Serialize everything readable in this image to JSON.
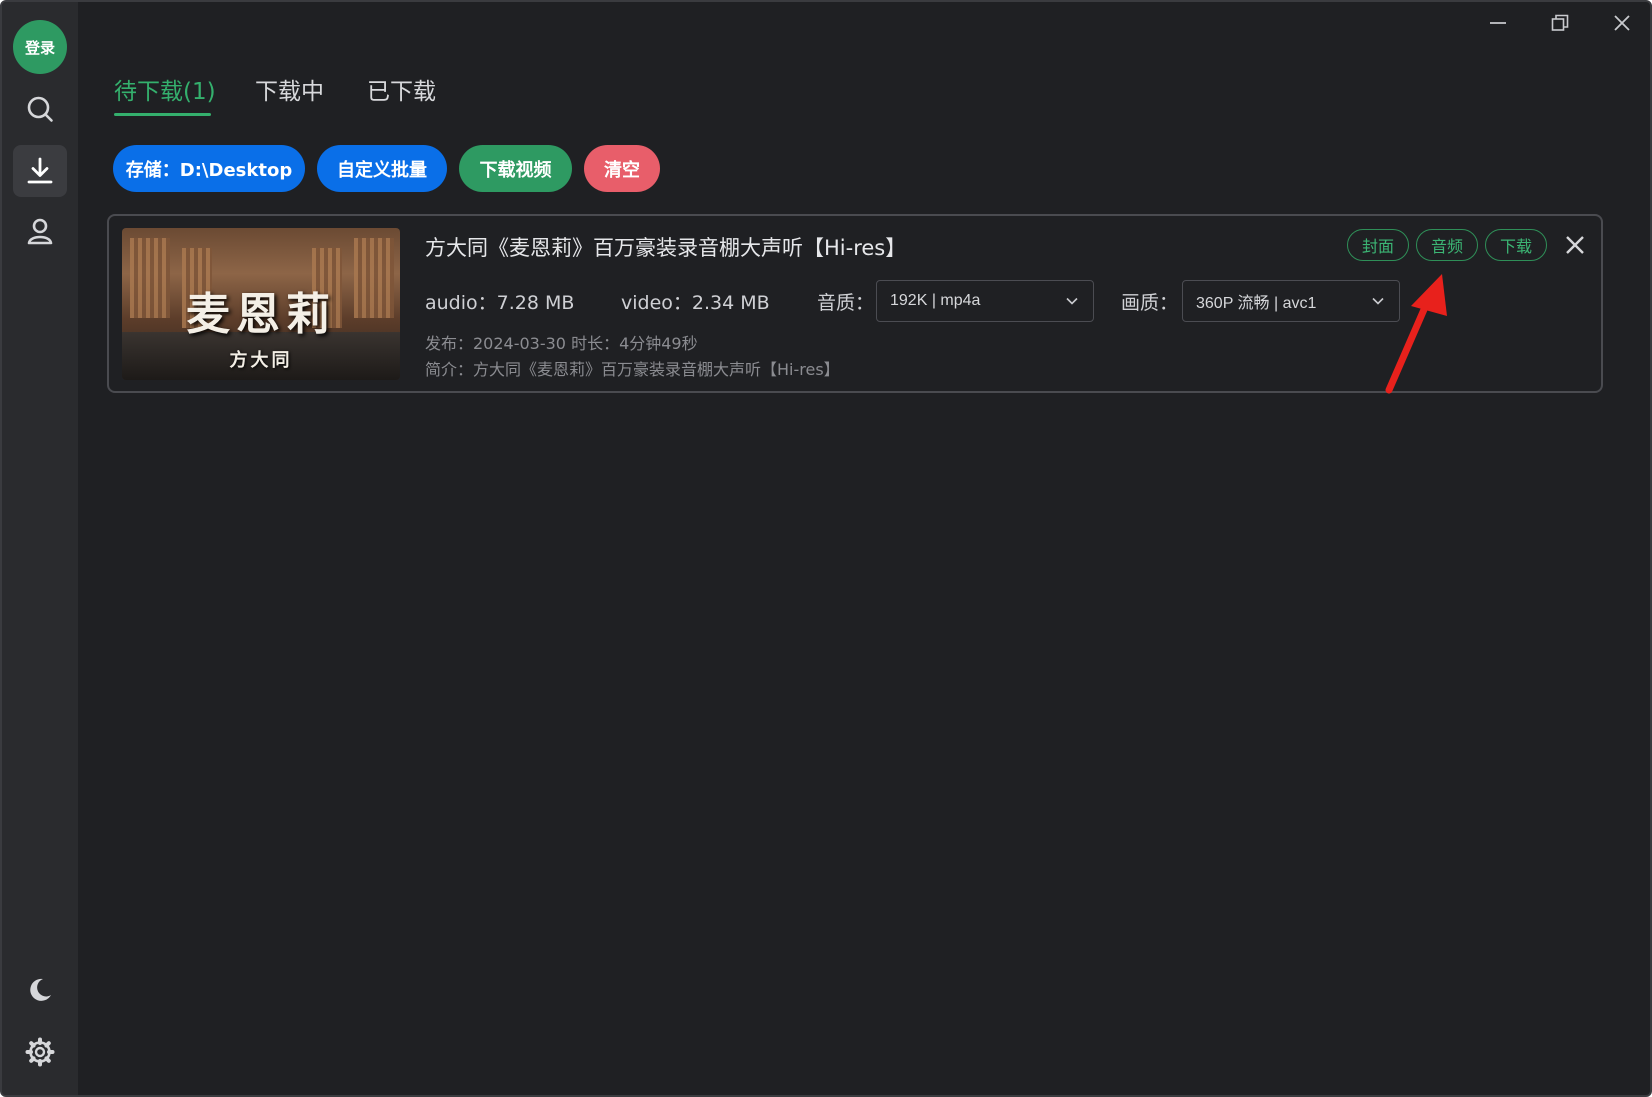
{
  "sidebar": {
    "avatar_label": "登录",
    "items": [
      {
        "icon": "search-icon"
      },
      {
        "icon": "download-icon",
        "active": true
      },
      {
        "icon": "user-icon"
      }
    ],
    "bottom": [
      {
        "icon": "moon-icon"
      },
      {
        "icon": "gear-icon"
      }
    ]
  },
  "tabs": [
    {
      "label": "待下载(1)",
      "active": true
    },
    {
      "label": "下载中"
    },
    {
      "label": "已下载"
    }
  ],
  "toolbar": {
    "storage_label": "存储：D:\\Desktop",
    "batch_label": "自定义批量",
    "download_video_label": "下载视频",
    "clear_label": "清空",
    "colors": {
      "blue": "#0a6fe8",
      "green": "#2e9a62",
      "red": "#e85e6a"
    }
  },
  "item": {
    "thumb_title": "麦恩莉",
    "thumb_artist": "方大同",
    "title": "方大同《麦恩莉》百万豪装录音棚大声听【Hi-res】",
    "audio_size": "audio：7.28 MB",
    "video_size": "video：2.34 MB",
    "audio_quality_label": "音质：",
    "audio_quality_value": "192K | mp4a",
    "video_quality_label": "画质：",
    "video_quality_value": "360P 流畅 | avc1",
    "publish": "发布：2024-03-30 时长：4分钟49秒",
    "intro": "简介：方大同《麦恩莉》百万豪装录音棚大声听【Hi-res】",
    "actions": {
      "cover": "封面",
      "audio": "音频",
      "download": "下载"
    }
  },
  "accent": "#34b06d",
  "annotation_color": "#e8211c"
}
